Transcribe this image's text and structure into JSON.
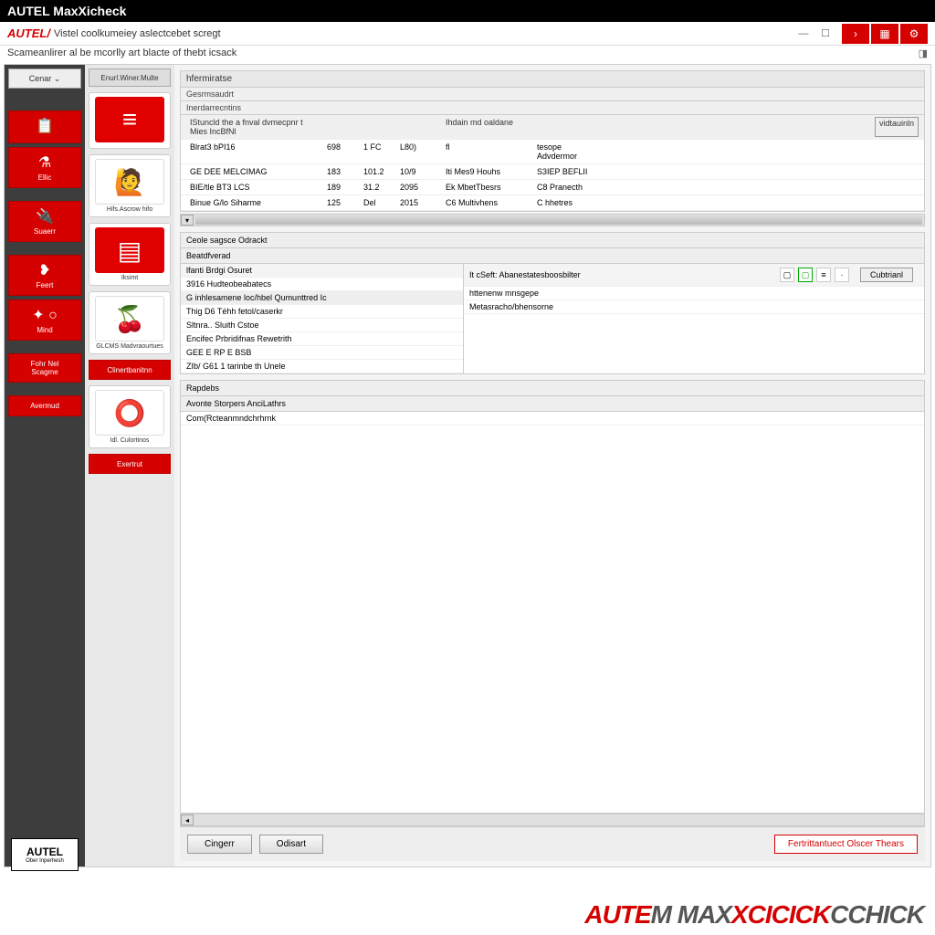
{
  "banner": {
    "text": "AUTEL MaxXicheck"
  },
  "window": {
    "title": "Vistel coolkumeiey aslectcebet scregt",
    "subtitle": "Scameanlirer al be mcorlly art blacte of thebt icsack"
  },
  "rail": {
    "dropdown": "Cenar ⌄",
    "items": [
      "",
      "⚗",
      "Ellic",
      "Suaerr",
      "Feert",
      "Mind",
      "Fohr Nel",
      "Scagme",
      "Avermud"
    ]
  },
  "tiles": {
    "tab": "Enurl.Winer.Multe",
    "items": [
      {
        "label": "",
        "iconStyle": "red",
        "glyph": "≡"
      },
      {
        "label": "Hifs.Ascrow hifo",
        "iconStyle": "white",
        "glyph": "👤"
      },
      {
        "label": "Iksimt",
        "iconStyle": "red",
        "glyph": "▤"
      },
      {
        "label": "GLCMS\nMadvraourtues",
        "iconStyle": "white",
        "glyph": "🍓"
      },
      {
        "label": "Idl.\nCulortinos",
        "iconStyle": "white",
        "glyph": "⭕"
      }
    ],
    "redBtns": [
      "Clinertbanitnn",
      "Exertrut"
    ]
  },
  "section": {
    "h1": "hfermiratse",
    "h2": "Gesrmsaudrt",
    "h3": "Inerdarrecntins",
    "tableHeader": {
      "c1": "IStuncld the a fnval dvmecpnr t Mies IncBfNl",
      "c5": "Ihdain md oaldane",
      "btn": "vidtauinln"
    },
    "rows": [
      {
        "c1": "Blrat3 bPI16",
        "c2": "698",
        "c3": "1 FC",
        "c4": "L80)",
        "c5": "fl",
        "c6": "tesope   Advdermor"
      },
      {
        "c1": "GE DEE MELCIMAG",
        "c2": "183",
        "c3": "101.2",
        "c4": "10/9",
        "c5": "Iti Mes9 Houhs",
        "c6": "S3IEP BEFLII"
      },
      {
        "c1": "BIE/tle BT3 LCS",
        "c2": "189",
        "c3": "31.2",
        "c4": "2095",
        "c5": "Ek MbetTbesrs",
        "c6": "C8 Pranecth"
      },
      {
        "c1": "Binue G/lo Siharme",
        "c2": "125",
        "c3": "Del",
        "c4": "2015",
        "c5": "C6 Multivhens",
        "c6": "C hhetres"
      }
    ]
  },
  "mid": {
    "h1": "Ceole sagsce Odrackt",
    "h2": "Beatdfverad",
    "leftHeader": "lfanti   Brdgi Osuret",
    "rightHeader": "It cSeft:  Abanestatesboosbilter",
    "leftRows": [
      "3916 Hudteobeabatecs",
      "G inhlesamene loc/hbel Qumunttred  Ic",
      "Thig D6 Téhh fetol/caserkr",
      "Sltnra.. Sluith Cstoe",
      "Encifec Prbridifnas Rewetrith",
      "GEE E RP E BSB",
      "ZIb/ G61 1 tarinbe th Unele"
    ],
    "rightRows": [
      "httenenw mnsgepe",
      "Metasracho/bhensorne"
    ],
    "sidebarBtn": "Cubtrianl"
  },
  "notes": {
    "h1": "Rapdebs",
    "h2": "Avonte Storpers AnciLathrs",
    "line": "Com(Rcteanmndchrhrnk"
  },
  "dialog": {
    "btn1": "Cingerr",
    "btn2": "Odisart",
    "btn3": "Fertrittantuect Olscer Thears"
  },
  "corner": {
    "brand": "AUTEL",
    "sub": "Ober Inperhesh"
  },
  "footerBrand": {
    "p1": "AUTE",
    "p2": "M MAX",
    "p3": "XCICICK",
    "p4": "CCHICK"
  }
}
